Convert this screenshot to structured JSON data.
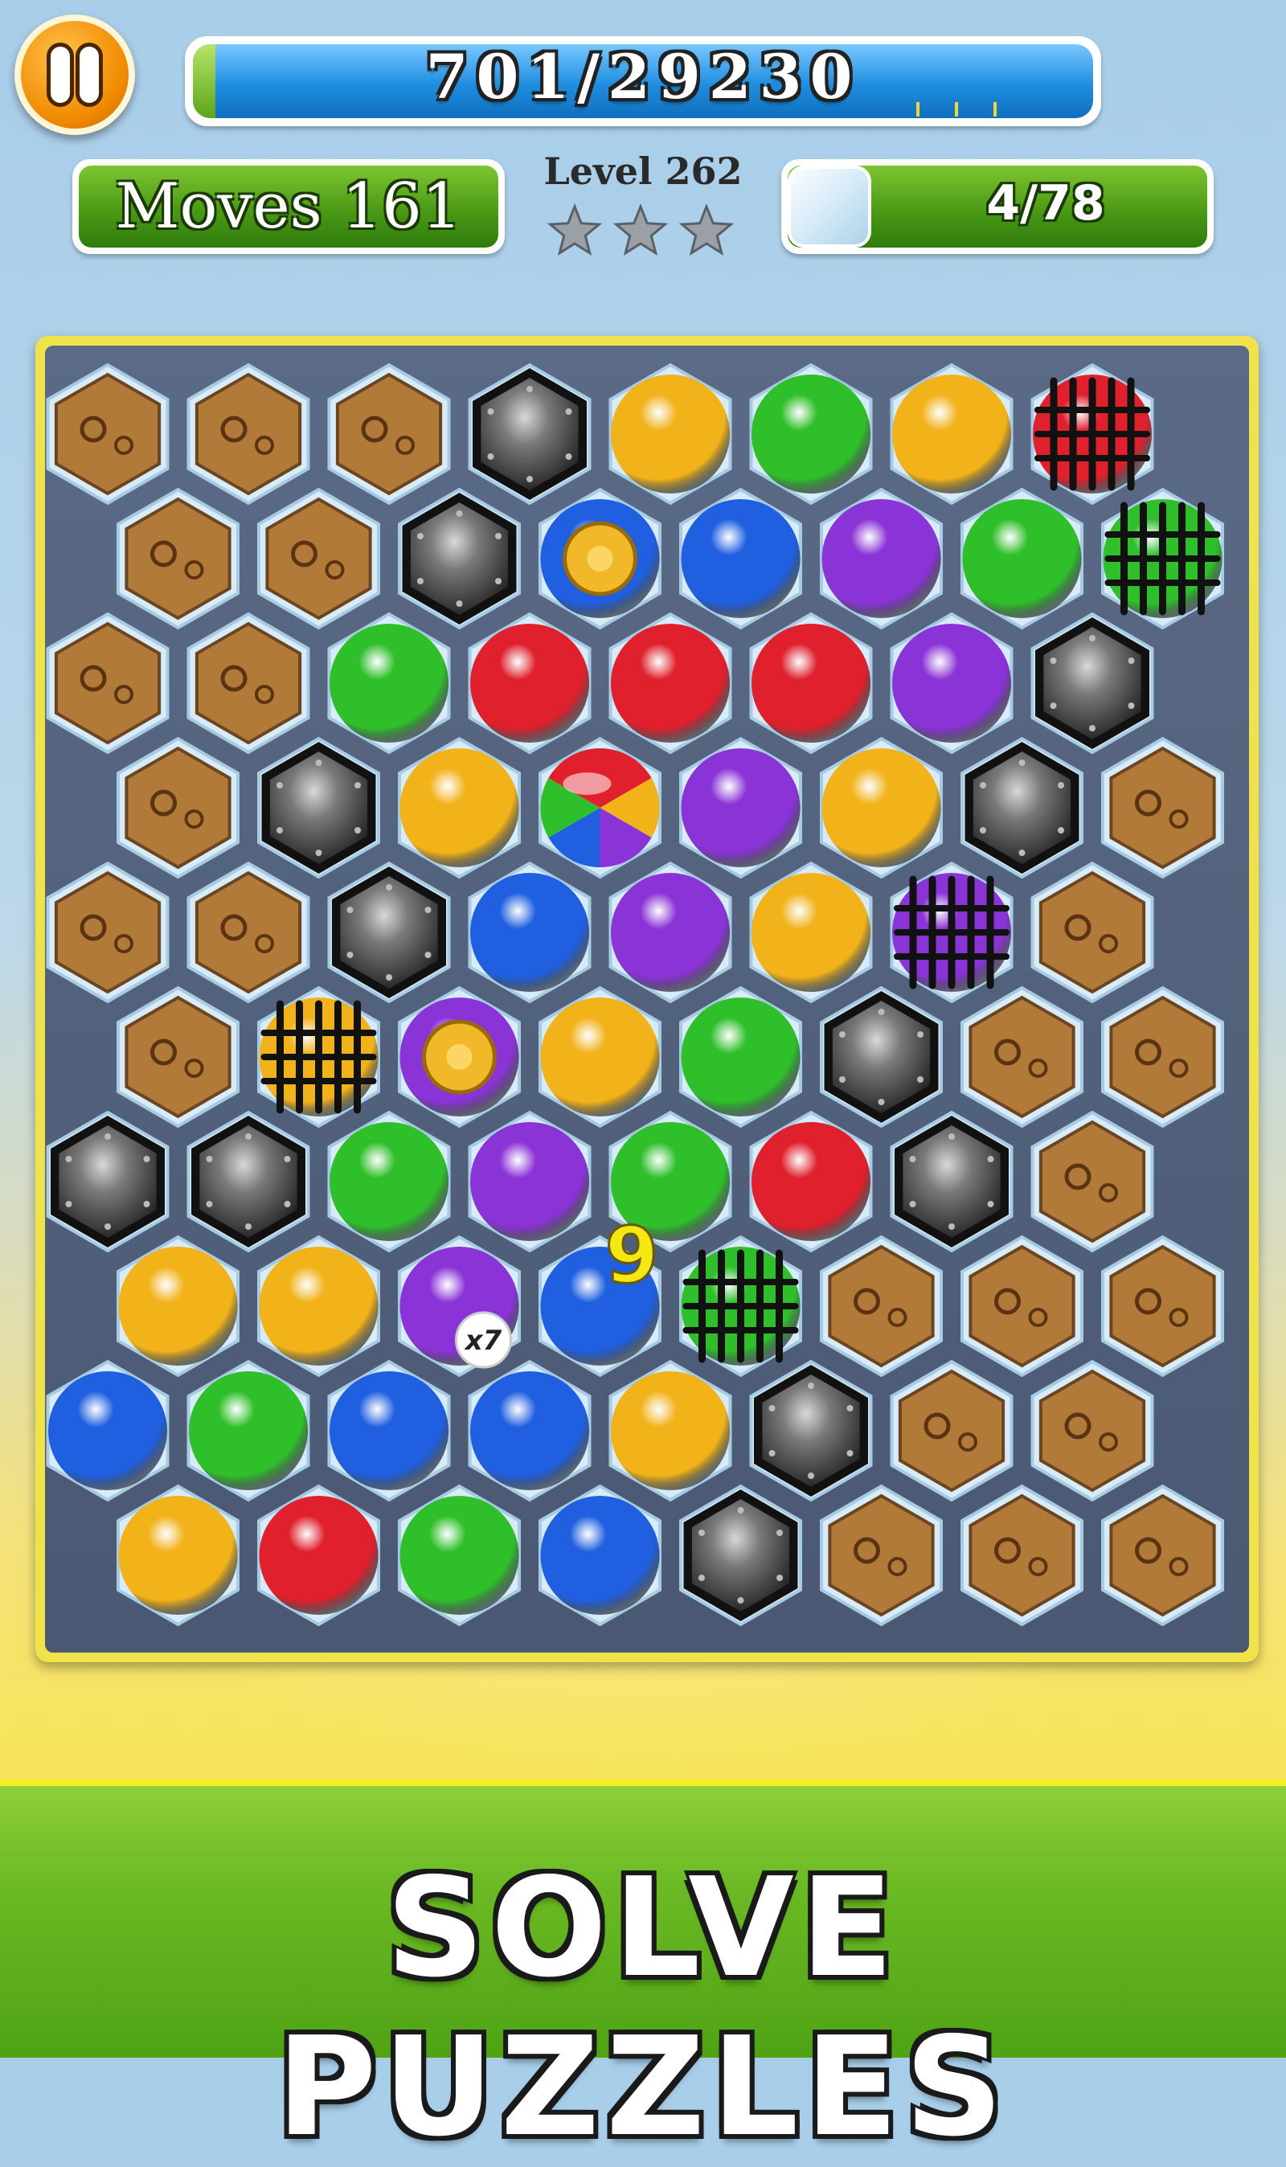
{
  "hud": {
    "score_text": "701/29230",
    "score": 701,
    "score_target": 29230,
    "moves_label": "Moves 161",
    "level_label": "Level 262",
    "stars_earned": 0,
    "stars_total": 3,
    "goal_icon": "ice-tile-icon",
    "goal_text": "4/78"
  },
  "board": {
    "cells": [
      [
        "stone",
        "stone",
        "stone",
        "metal",
        "yellow",
        "green",
        "yellow",
        "red-cage"
      ],
      [
        "stone",
        "stone",
        "metal",
        "blue-coin",
        "blue",
        "purple",
        "green",
        "green-cage"
      ],
      [
        "stone",
        "stone",
        "green",
        "red",
        "red",
        "red",
        "purple",
        "metal"
      ],
      [
        "stone",
        "metal",
        "yellow",
        "rainbow",
        "purple",
        "yellow",
        "metal",
        "stone"
      ],
      [
        "stone",
        "stone",
        "metal",
        "blue",
        "purple",
        "yellow",
        "purple-cage",
        "stone"
      ],
      [
        "stone",
        "yellow-cage",
        "purple-coin",
        "yellow",
        "green",
        "metal",
        "stone",
        "stone"
      ],
      [
        "metal",
        "metal",
        "green",
        "purple",
        "green",
        "red",
        "metal",
        "stone"
      ],
      [
        "yellow",
        "yellow",
        "purple-x7",
        "blue",
        "green-cage",
        "stone",
        "stone",
        "stone"
      ],
      [
        "blue",
        "green",
        "blue",
        "blue",
        "yellow",
        "metal",
        "stone",
        "stone"
      ],
      [
        "yellow",
        "red",
        "green",
        "blue",
        "metal",
        "stone",
        "stone",
        "stone"
      ]
    ],
    "multiplier_text": "x7",
    "floating_score": "9",
    "colors": {
      "red": "#e0202c",
      "green": "#2fbf2a",
      "blue": "#1f5fe0",
      "yellow": "#f2b21a",
      "purple": "#8a33d6",
      "metal": "#3a3a3a",
      "stone": "#b27a38",
      "coin": "#f1b82a"
    }
  },
  "banner": {
    "text": "SOLVE PUZZLES"
  }
}
